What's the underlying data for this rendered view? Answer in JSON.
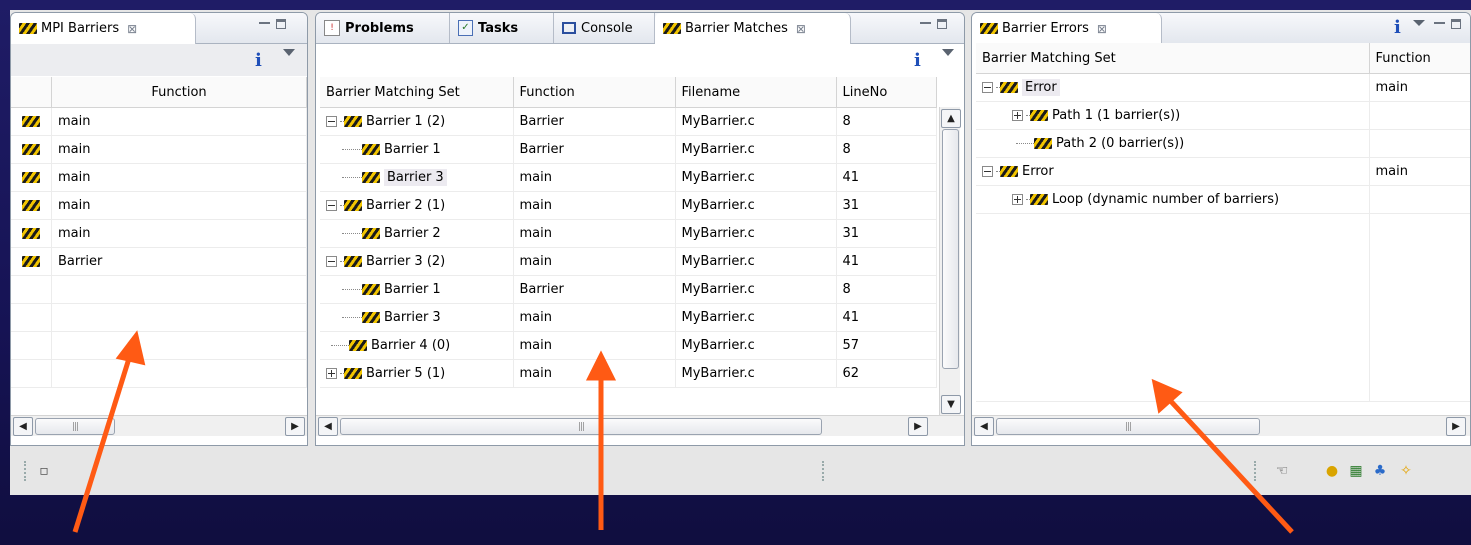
{
  "views": {
    "mpi_barriers": {
      "tab_label": "MPI Barriers",
      "column_function": "Function",
      "rows": [
        "main",
        "main",
        "main",
        "main",
        "main",
        "Barrier"
      ]
    },
    "center": {
      "tabs": [
        "Problems",
        "Tasks",
        "Console",
        "Barrier Matches"
      ],
      "columns": [
        "Barrier Matching Set",
        "Function",
        "Filename",
        "LineNo"
      ],
      "rows": [
        {
          "label": "Barrier 1 (2)",
          "function": "Barrier",
          "filename": "MyBarrier.c",
          "line": "8"
        },
        {
          "label": "Barrier 1",
          "function": "Barrier",
          "filename": "MyBarrier.c",
          "line": "8"
        },
        {
          "label": "Barrier 3",
          "function": "main",
          "filename": "MyBarrier.c",
          "line": "41"
        },
        {
          "label": "Barrier 2 (1)",
          "function": "main",
          "filename": "MyBarrier.c",
          "line": "31"
        },
        {
          "label": "Barrier 2",
          "function": "main",
          "filename": "MyBarrier.c",
          "line": "31"
        },
        {
          "label": "Barrier 3 (2)",
          "function": "main",
          "filename": "MyBarrier.c",
          "line": "41"
        },
        {
          "label": "Barrier 1",
          "function": "Barrier",
          "filename": "MyBarrier.c",
          "line": "8"
        },
        {
          "label": "Barrier 3",
          "function": "main",
          "filename": "MyBarrier.c",
          "line": "41"
        },
        {
          "label": "Barrier 4 (0)",
          "function": "main",
          "filename": "MyBarrier.c",
          "line": "57"
        },
        {
          "label": "Barrier 5 (1)",
          "function": "main",
          "filename": "MyBarrier.c",
          "line": "62"
        }
      ]
    },
    "barrier_errors": {
      "tab_label": "Barrier Errors",
      "columns": [
        "Barrier Matching Set",
        "Function"
      ],
      "rows": [
        {
          "label": "Error",
          "function": "main"
        },
        {
          "label": "Path 1 (1 barrier(s))",
          "function": ""
        },
        {
          "label": "Path 2 (0 barrier(s))",
          "function": ""
        },
        {
          "label": "Error",
          "function": "main"
        },
        {
          "label": "Loop (dynamic number of barriers)",
          "function": ""
        }
      ]
    }
  },
  "icons": {
    "barrier": "barrier-stripes-icon",
    "info": "i",
    "close": "⊠"
  },
  "colors": {
    "background": "#1a1760",
    "arrow": "#ff5a14",
    "barrier_yellow": "#f2c500"
  }
}
